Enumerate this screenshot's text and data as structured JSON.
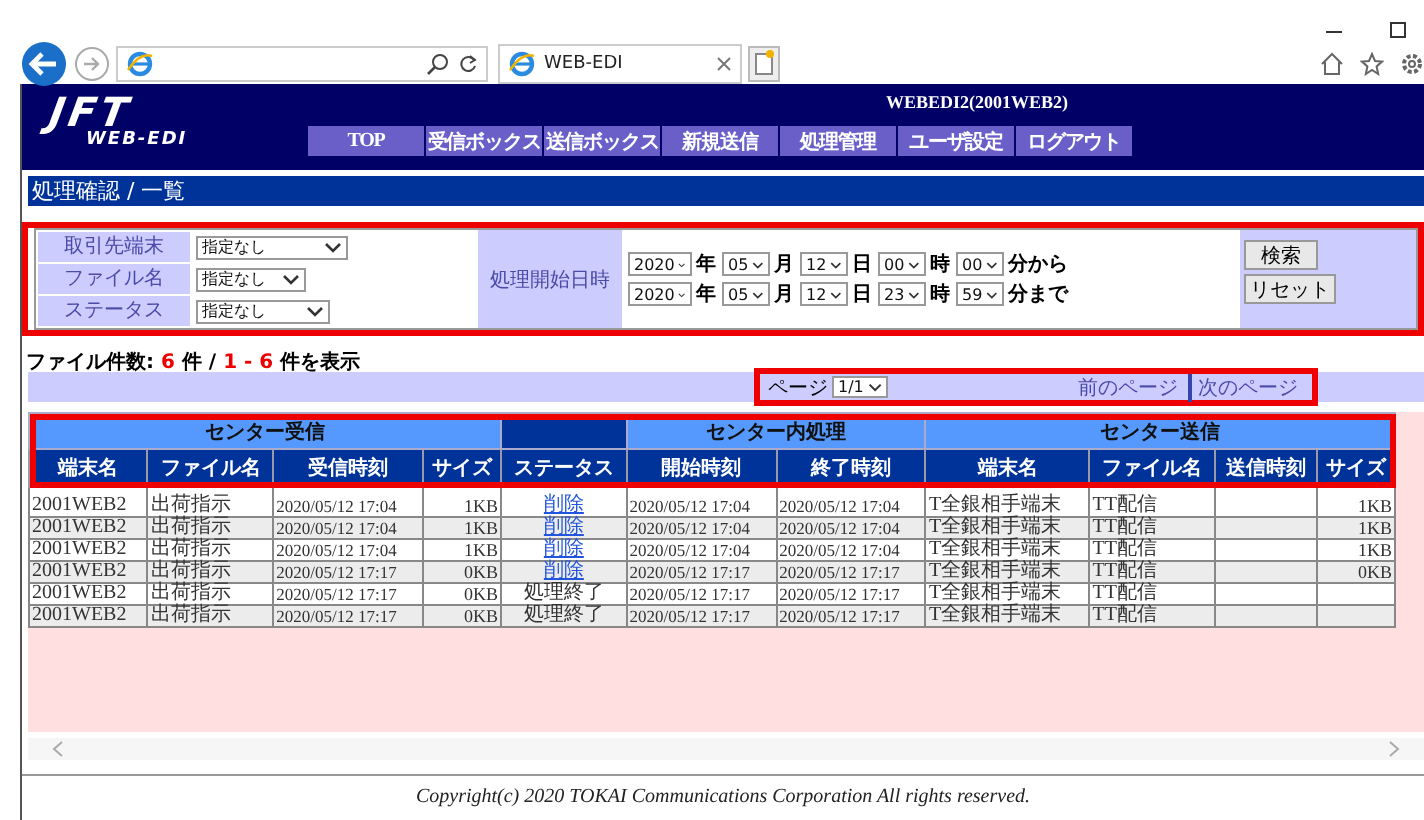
{
  "browser": {
    "tab_title": "WEB-EDI"
  },
  "header": {
    "logo_top": "JFT",
    "logo_bottom": "WEB-EDI",
    "user": "WEBEDI2(2001WEB2)",
    "nav": [
      "TOP",
      "受信ボックス",
      "送信ボックス",
      "新規送信",
      "処理管理",
      "ユーザ設定",
      "ログアウト"
    ]
  },
  "page_title": "処理確認 / 一覧",
  "filters": [
    {
      "label": "取引先端末",
      "value": "指定なし"
    },
    {
      "label": "ファイル名",
      "value": "指定なし"
    },
    {
      "label": "ステータス",
      "value": "指定なし"
    }
  ],
  "date_label": "処理開始日時",
  "date_rows": [
    {
      "fields": [
        {
          "value": "2020",
          "unit": "年"
        },
        {
          "value": "05",
          "unit": "月"
        },
        {
          "value": "12",
          "unit": "日"
        },
        {
          "value": "00",
          "unit": "時"
        },
        {
          "value": "00",
          "unit": "分から"
        }
      ]
    },
    {
      "fields": [
        {
          "value": "2020",
          "unit": "年"
        },
        {
          "value": "05",
          "unit": "月"
        },
        {
          "value": "12",
          "unit": "日"
        },
        {
          "value": "23",
          "unit": "時"
        },
        {
          "value": "59",
          "unit": "分まで"
        }
      ]
    }
  ],
  "buttons": [
    "検索",
    "リセット"
  ],
  "summary": [
    {
      "text": "ファイル件数: ",
      "highlight": false
    },
    {
      "text": "6",
      "highlight": true
    },
    {
      "text": " 件 / ",
      "highlight": false
    },
    {
      "text": "1 - 6",
      "highlight": true
    },
    {
      "text": " 件を表示",
      "highlight": false
    }
  ],
  "pager": {
    "label": "ページ",
    "value": "1/1",
    "prev": "前のページ",
    "next": "次のページ"
  },
  "table": {
    "groups": [
      {
        "label": "センター受信",
        "columns": [
          {
            "label": "端末名",
            "kind": "text"
          },
          {
            "label": "ファイル名",
            "kind": "text"
          },
          {
            "label": "受信時刻",
            "kind": "time"
          },
          {
            "label": "サイズ",
            "kind": "size"
          }
        ]
      },
      {
        "columns": [
          {
            "label": "ステータス",
            "kind": "status"
          }
        ]
      },
      {
        "label": "センター内処理",
        "columns": [
          {
            "label": "開始時刻",
            "kind": "time"
          },
          {
            "label": "終了時刻",
            "kind": "time"
          }
        ]
      },
      {
        "label": "センター送信",
        "columns": [
          {
            "label": "端末名",
            "kind": "text"
          },
          {
            "label": "ファイル名",
            "kind": "text"
          },
          {
            "label": "送信時刻",
            "kind": "time"
          },
          {
            "label": "サイズ",
            "kind": "size"
          }
        ]
      }
    ],
    "rows": [
      {
        "status_link": true,
        "cells": [
          "2001WEB2",
          "出荷指示",
          "2020/05/12 17:04",
          "1KB",
          "削除",
          "2020/05/12 17:04",
          "2020/05/12 17:04",
          "T全銀相手端末",
          "TT配信",
          null,
          "1KB"
        ]
      },
      {
        "status_link": true,
        "cells": [
          "2001WEB2",
          "出荷指示",
          "2020/05/12 17:04",
          "1KB",
          "削除",
          "2020/05/12 17:04",
          "2020/05/12 17:04",
          "T全銀相手端末",
          "TT配信",
          null,
          "1KB"
        ]
      },
      {
        "status_link": true,
        "cells": [
          "2001WEB2",
          "出荷指示",
          "2020/05/12 17:04",
          "1KB",
          "削除",
          "2020/05/12 17:04",
          "2020/05/12 17:04",
          "T全銀相手端末",
          "TT配信",
          null,
          "1KB"
        ]
      },
      {
        "status_link": true,
        "cells": [
          "2001WEB2",
          "出荷指示",
          "2020/05/12 17:17",
          "0KB",
          "削除",
          "2020/05/12 17:17",
          "2020/05/12 17:17",
          "T全銀相手端末",
          "TT配信",
          null,
          "0KB"
        ]
      },
      {
        "status_link": false,
        "cells": [
          "2001WEB2",
          "出荷指示",
          "2020/05/12 17:17",
          "0KB",
          "処理終了",
          "2020/05/12 17:17",
          "2020/05/12 17:17",
          "T全銀相手端末",
          "TT配信",
          null,
          null
        ]
      },
      {
        "status_link": false,
        "cells": [
          "2001WEB2",
          "出荷指示",
          "2020/05/12 17:17",
          "0KB",
          "処理終了",
          "2020/05/12 17:17",
          "2020/05/12 17:17",
          "T全銀相手端末",
          "TT配信",
          null,
          null
        ]
      }
    ]
  },
  "footer": "Copyright(c) 2020 TOKAI Communications Corporation All rights reserved."
}
